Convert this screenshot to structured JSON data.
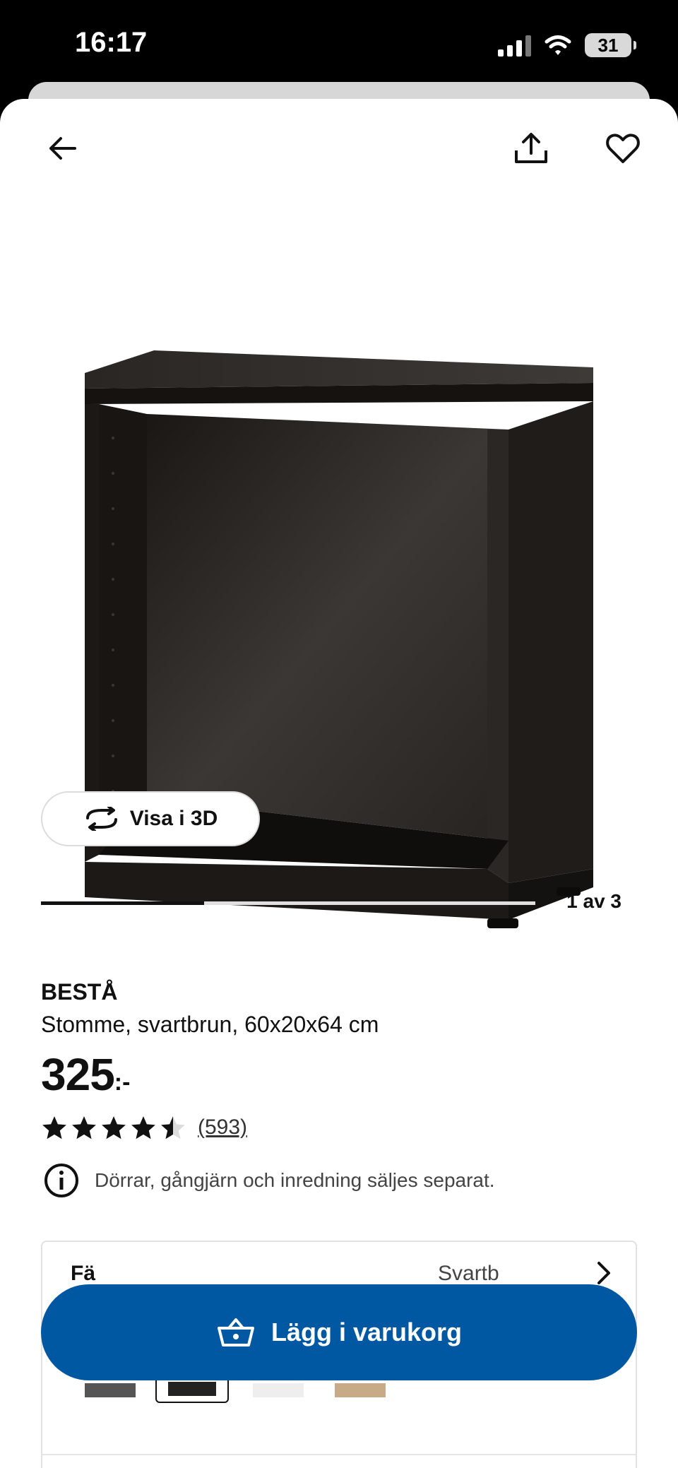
{
  "status_bar": {
    "time": "16:17",
    "battery": "31"
  },
  "header": {
    "back_icon": "arrow-left-icon",
    "share_icon": "share-icon",
    "favorite_icon": "heart-icon"
  },
  "gallery": {
    "view_3d_label": "Visa i 3D",
    "page_indicator": "1 av 3",
    "progress_fraction": 0.33
  },
  "product": {
    "brand": "BESTÅ",
    "description": "Stomme, svartbrun, 60x20x64 cm",
    "price": "325",
    "price_suffix": ":-",
    "rating_value": 4.5,
    "rating_max": 5,
    "review_count": "(593)",
    "notice": "Dörrar, gångjärn och inredning säljes separat."
  },
  "variant": {
    "label": "Fä",
    "value": "Svartb"
  },
  "cart": {
    "button_label": "Lägg i varukorg"
  },
  "colors": {
    "accent": "#0058a3",
    "text": "#111111"
  }
}
